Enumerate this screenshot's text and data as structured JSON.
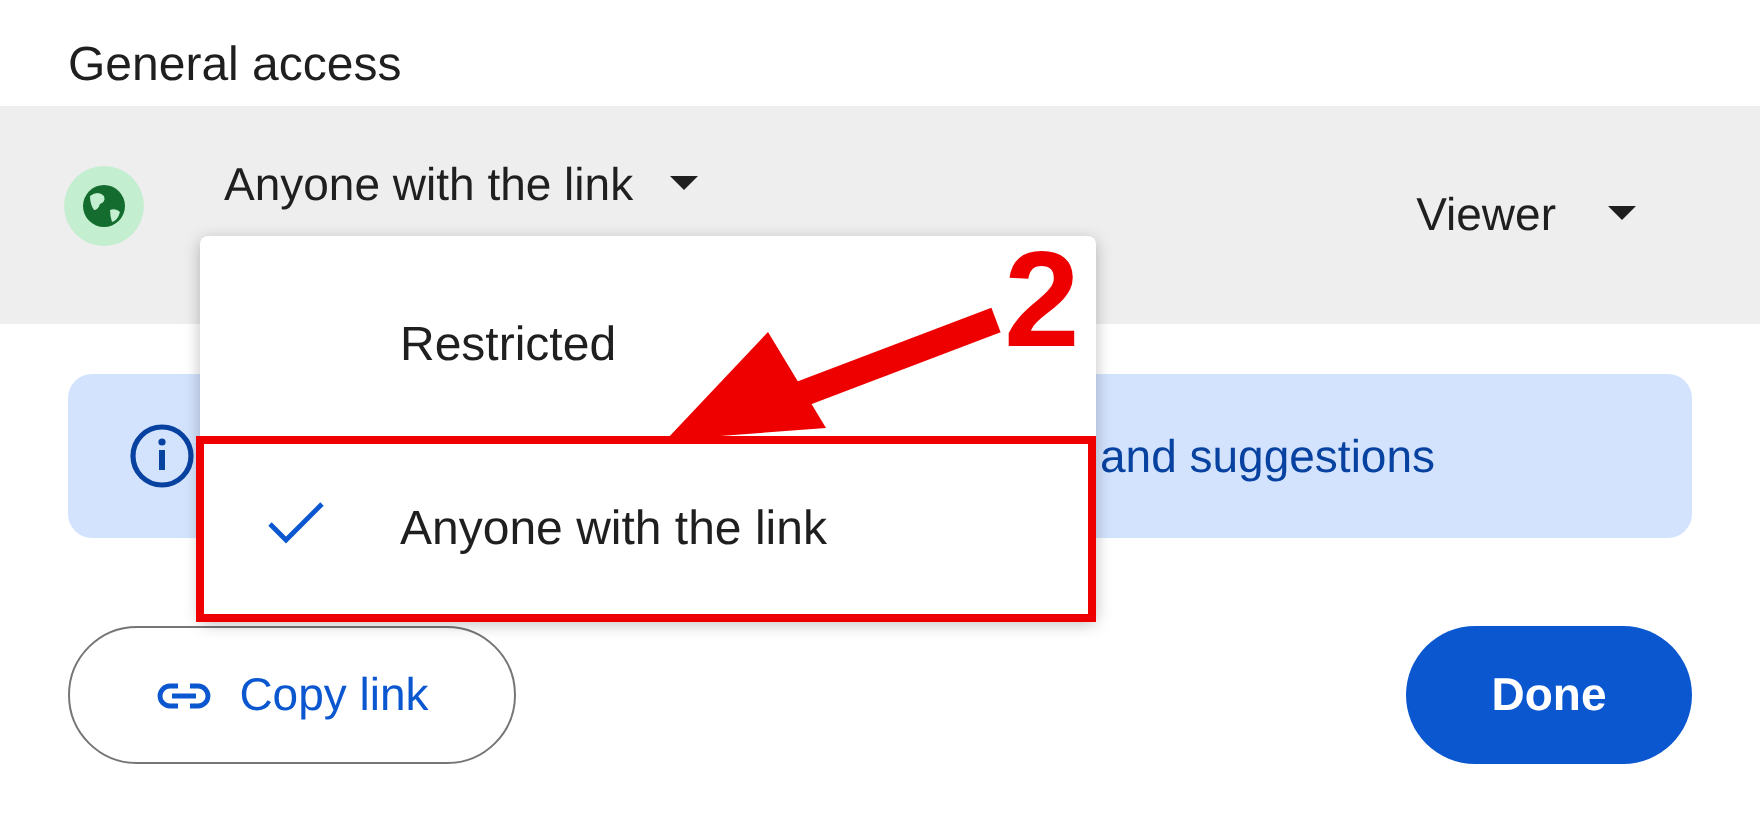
{
  "heading": "General access",
  "access": {
    "value": "Anyone with the link"
  },
  "role": {
    "value": "Viewer"
  },
  "banner": {
    "text": "and suggestions"
  },
  "menu": {
    "items": [
      {
        "label": "Restricted",
        "selected": false
      },
      {
        "label": "Anyone with the link",
        "selected": true
      }
    ]
  },
  "buttons": {
    "copy_link": "Copy link",
    "done": "Done"
  },
  "annotation": {
    "label": "2"
  }
}
